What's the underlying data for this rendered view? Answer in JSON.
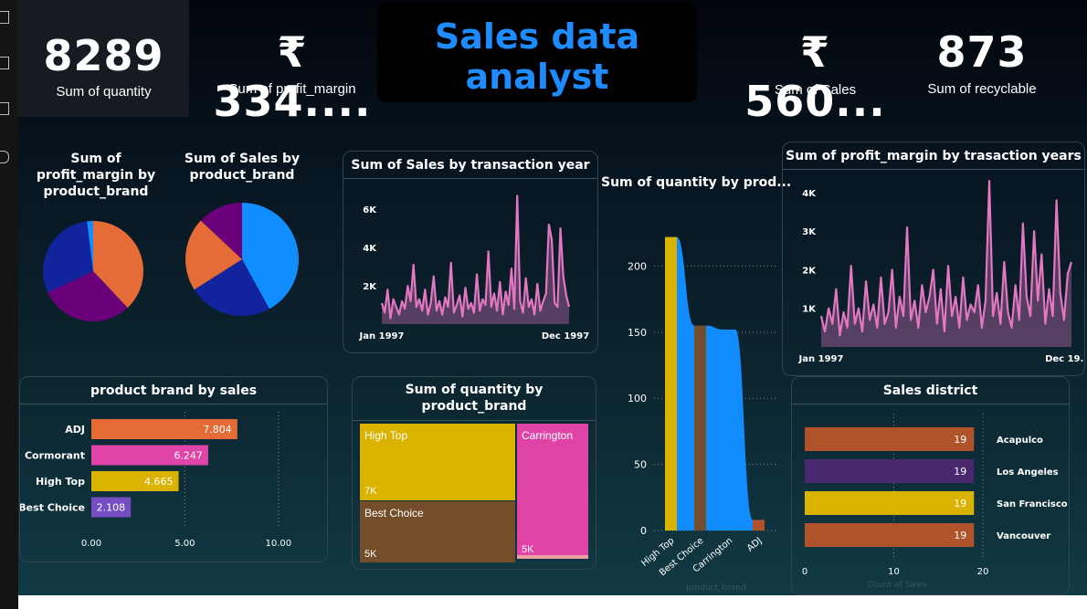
{
  "kpis": {
    "quantity": {
      "value": "8289",
      "label": "Sum of quantity"
    },
    "profit": {
      "value": "₹ 334....",
      "label": "Sum of profit_margin"
    },
    "sales": {
      "value": "₹ 560...",
      "label": "Sum of Sales"
    },
    "recyclable": {
      "value": "873",
      "label": "Sum of recyclable"
    }
  },
  "dashboard_title": "Sales data analyst",
  "colors": {
    "blue": "#118dff",
    "navy": "#12239e",
    "orange": "#e66c37",
    "purple": "#6b007b",
    "pink": "#e044a7",
    "gold": "#d9b300",
    "brown": "#744ec2",
    "rust": "#b0532a",
    "line": "#e377c2"
  },
  "chart_data": [
    {
      "id": "pie_profit",
      "type": "pie",
      "title": "Sum of profit_margin by product_brand",
      "title_lines": [
        "Sum of",
        "profit_margin by",
        "product_brand"
      ],
      "slices": [
        {
          "value": 38,
          "color": "#e66c37"
        },
        {
          "value": 30,
          "color": "#6b007b"
        },
        {
          "value": 30,
          "color": "#12239e"
        },
        {
          "value": 2,
          "color": "#118dff"
        }
      ]
    },
    {
      "id": "pie_sales",
      "type": "pie",
      "title": "Sum of Sales by product_brand",
      "title_lines": [
        "Sum of Sales by",
        "product_brand"
      ],
      "slices": [
        {
          "value": 42,
          "color": "#118dff"
        },
        {
          "value": 24,
          "color": "#12239e"
        },
        {
          "value": 21,
          "color": "#e66c37"
        },
        {
          "value": 13,
          "color": "#6b007b"
        }
      ]
    },
    {
      "id": "line_sales",
      "type": "area",
      "title": "Sum of Sales by transaction year",
      "ylim": [
        0,
        7200
      ],
      "yticks": [
        {
          "v": 2000,
          "label": "2K"
        },
        {
          "v": 4000,
          "label": "4K"
        },
        {
          "v": 6000,
          "label": "6K"
        }
      ],
      "x_start": "Jan 1997",
      "x_end": "Dec 1997",
      "values": [
        1100,
        600,
        1800,
        300,
        1300,
        900,
        500,
        1200,
        800,
        2000,
        1200,
        3100,
        900,
        1300,
        700,
        1800,
        500,
        1100,
        2500,
        700,
        1200,
        500,
        1400,
        900,
        3200,
        600,
        1000,
        1500,
        400,
        1900,
        800,
        1100,
        600,
        2600,
        700,
        1300,
        1000,
        3800,
        900,
        1600,
        700,
        2200,
        500,
        1700,
        1000,
        2900,
        800,
        6700,
        1200,
        600,
        2400,
        900,
        1300,
        500,
        2100,
        700,
        1200,
        1600,
        5200,
        4400,
        1100,
        900,
        5000,
        2500,
        1500,
        900
      ]
    },
    {
      "id": "line_profit",
      "type": "area",
      "title": "Sum of profit_margin by trasaction years",
      "ylim": [
        0,
        4400
      ],
      "yticks": [
        {
          "v": 1000,
          "label": "1K"
        },
        {
          "v": 2000,
          "label": "2K"
        },
        {
          "v": 3000,
          "label": "3K"
        },
        {
          "v": 4000,
          "label": "4K"
        }
      ],
      "x_start": "Jan 1997",
      "x_end": "Dec 19...",
      "values": [
        800,
        400,
        1000,
        600,
        1500,
        300,
        900,
        500,
        2100,
        600,
        1000,
        400,
        1700,
        700,
        1100,
        500,
        1800,
        600,
        900,
        2000,
        500,
        1300,
        800,
        3100,
        700,
        1200,
        500,
        1600,
        900,
        1300,
        2000,
        600,
        1500,
        400,
        2100,
        800,
        1300,
        500,
        1800,
        700,
        1100,
        900,
        1600,
        500,
        1200,
        4300,
        800,
        1400,
        600,
        2200,
        900,
        500,
        1600,
        700,
        3200,
        1300,
        800,
        3000,
        1200,
        2400,
        600,
        1500,
        800,
        3800,
        1400,
        700,
        1900,
        2200
      ]
    },
    {
      "id": "bar_brand_sales",
      "type": "bar",
      "title": "product brand by sales",
      "categories": [
        "ADJ",
        "Cormorant",
        "High Top",
        "Best Choice"
      ],
      "values": [
        7.804,
        6.247,
        4.665,
        2.108
      ],
      "labels": [
        "7.804",
        "6.247",
        "4.665",
        "2.108"
      ],
      "colors": [
        "#e66c37",
        "#e044a7",
        "#d9b300",
        "#744ec2"
      ],
      "xlim": [
        0,
        12.5
      ],
      "xticks": [
        {
          "v": 0,
          "label": "0.00"
        },
        {
          "v": 5,
          "label": "5.00"
        },
        {
          "v": 10,
          "label": "10.00"
        }
      ]
    },
    {
      "id": "treemap_quantity",
      "type": "treemap",
      "title": "Sum of quantity by product_brand",
      "title_lines": [
        "Sum of quantity by",
        "product_brand"
      ],
      "cells": [
        {
          "name": "High Top",
          "value_label": "7K",
          "color": "#d9b300"
        },
        {
          "name": "Carrington",
          "value_label": "5K",
          "color": "#e044a7"
        },
        {
          "name": "Best Choice",
          "value_label": "5K",
          "color": "#744e2a"
        }
      ]
    },
    {
      "id": "ribbon_quantity",
      "type": "bar",
      "title": "Sum of quantity by prod...",
      "categories": [
        "High Top",
        "Best Choice",
        "Carrington",
        "ADJ"
      ],
      "values": [
        222,
        155,
        152,
        8
      ],
      "colors": [
        "#d9b300",
        "#744e2a",
        "#118dff",
        "#b0532a"
      ],
      "ylim": [
        0,
        230
      ],
      "yticks": [
        0,
        50,
        100,
        150,
        200
      ],
      "xlabel": "product_brand"
    },
    {
      "id": "bar_district",
      "type": "bar",
      "title": "Sales district",
      "categories": [
        "Acapulco",
        "Los Angeles",
        "San Francisco",
        "Vancouver"
      ],
      "values": [
        19,
        19,
        19,
        19
      ],
      "colors": [
        "#b0532a",
        "#4a2870",
        "#d9b300",
        "#b0532a"
      ],
      "xlim": [
        0,
        20
      ],
      "xticks": [
        0,
        10,
        20
      ],
      "xlabel": "Count of Sales"
    }
  ]
}
